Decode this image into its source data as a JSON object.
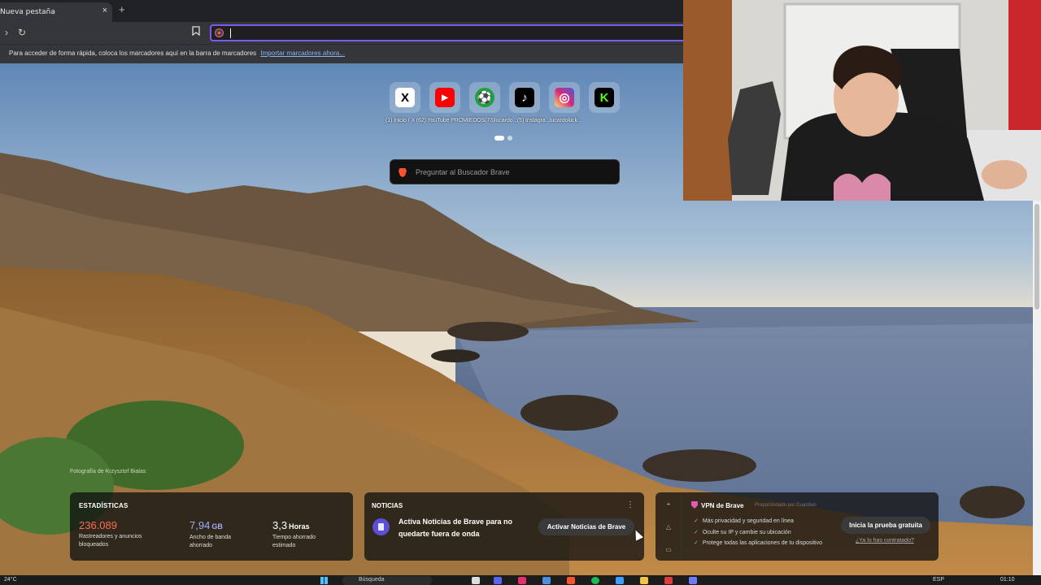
{
  "browser": {
    "tab_title": "Nueva pestaña",
    "tab_close": "×",
    "new_tab": "+",
    "bookmarks_hint": "Para acceder de forma rápida, coloca los marcadores aquí en la barra de marcadores",
    "bookmarks_import": "Importar marcadores ahora...",
    "accent_color": "#7a5cf5"
  },
  "top_sites": {
    "sites": [
      {
        "icon": "x-icon",
        "glyph": "𝕏",
        "bg": "#ffffff",
        "fg": "#000000"
      },
      {
        "icon": "youtube-icon",
        "glyph": "▶",
        "bg": "#ff0000",
        "fg": "#ffffff"
      },
      {
        "icon": "promiedos-icon",
        "glyph": "⚽",
        "bg": "#1aa33a",
        "fg": "#ffffff"
      },
      {
        "icon": "tiktok-icon",
        "glyph": "♪",
        "bg": "#000000",
        "fg": "#ffffff"
      },
      {
        "icon": "instagram-icon",
        "glyph": "◎",
        "bg": "#d62976",
        "fg": "#ffffff"
      },
      {
        "icon": "kick-icon",
        "glyph": "K",
        "bg": "#000000",
        "fg": "#53fc18"
      }
    ],
    "labels": "(1) Inicio / X  (62) YouTube  PROMIEDOS(73)lucardo...(5) Instagra...lucardokick..."
  },
  "search": {
    "placeholder": "Preguntar al Buscador Brave"
  },
  "photo_credit": "Fotografía de Krzysztof Bialas",
  "stats": {
    "title": "ESTADÍSTICAS",
    "trackers_value": "236.089",
    "trackers_label": "Rastreadores y anuncios bloqueados",
    "bandwidth_value": "7,94",
    "bandwidth_unit": "GB",
    "bandwidth_label": "Ancho de banda ahorrado",
    "time_value": "3,3",
    "time_unit": "Horas",
    "time_label": "Tiempo ahorrado estimado",
    "trackers_color": "#ff6a55",
    "bandwidth_color": "#9fa8ff"
  },
  "news": {
    "title": "NOTICIAS",
    "menu": "⋮",
    "message": "Activa Noticias de Brave para no quedarte fuera de onda",
    "button": "Activar Noticias de Brave"
  },
  "vpn": {
    "title": "VPN de Brave",
    "powered_by": "Proporcionado por  Guardian",
    "features": [
      "Más privacidad y seguridad en línea",
      "Oculte su IP y cambie su ubicación",
      "Protege todas las aplicaciones de tu dispositivo"
    ],
    "trial_button": "Inicia la prueba gratuita",
    "already_link": "¿Ya lo has contratado?"
  },
  "taskbar": {
    "temperature": "24°C",
    "search_label": "Búsqueda",
    "language": "ESP",
    "time": "01:10"
  }
}
